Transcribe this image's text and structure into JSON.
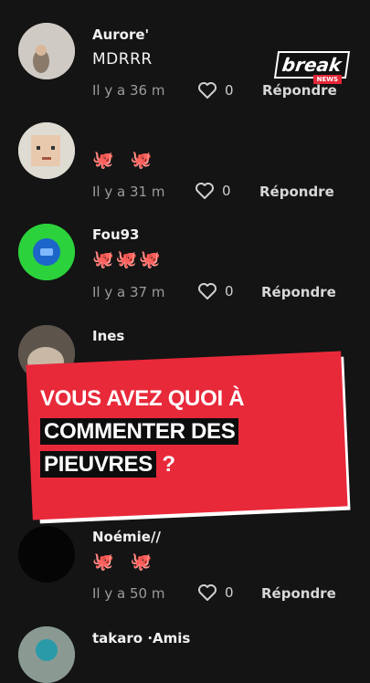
{
  "comments": [
    {
      "username": "Aurore'",
      "text": "MDRRR",
      "time": "Il y a 36 m",
      "likes": "0",
      "reply": "Répondre"
    },
    {
      "username": "",
      "text": "🐙 🐙",
      "time": "Il y a 31 m",
      "likes": "0",
      "reply": "Répondre"
    },
    {
      "username": "Fou93",
      "text": "🐙🐙🐙",
      "time": "Il y a 37 m",
      "likes": "0",
      "reply": "Répondre"
    },
    {
      "username": "Ines",
      "text": "",
      "time": "",
      "likes": "",
      "reply": ""
    },
    {
      "username": "Noémie//",
      "text": "🐙 🐙",
      "time": "Il y a 50 m",
      "likes": "0",
      "reply": "Répondre"
    },
    {
      "username": "takaro ·Amis",
      "text": "",
      "time": "",
      "likes": "",
      "reply": ""
    }
  ],
  "logo": {
    "word": "break",
    "sub": "NEWS"
  },
  "banner": {
    "line1": "VOUS AVEZ QUOI À",
    "line2": "COMMENTER DES",
    "line3": "PIEUVRES",
    "line3_suffix": " ?"
  },
  "colors": {
    "banner": "#e8293a",
    "background": "#141414",
    "accent_logo": "#e32636"
  }
}
